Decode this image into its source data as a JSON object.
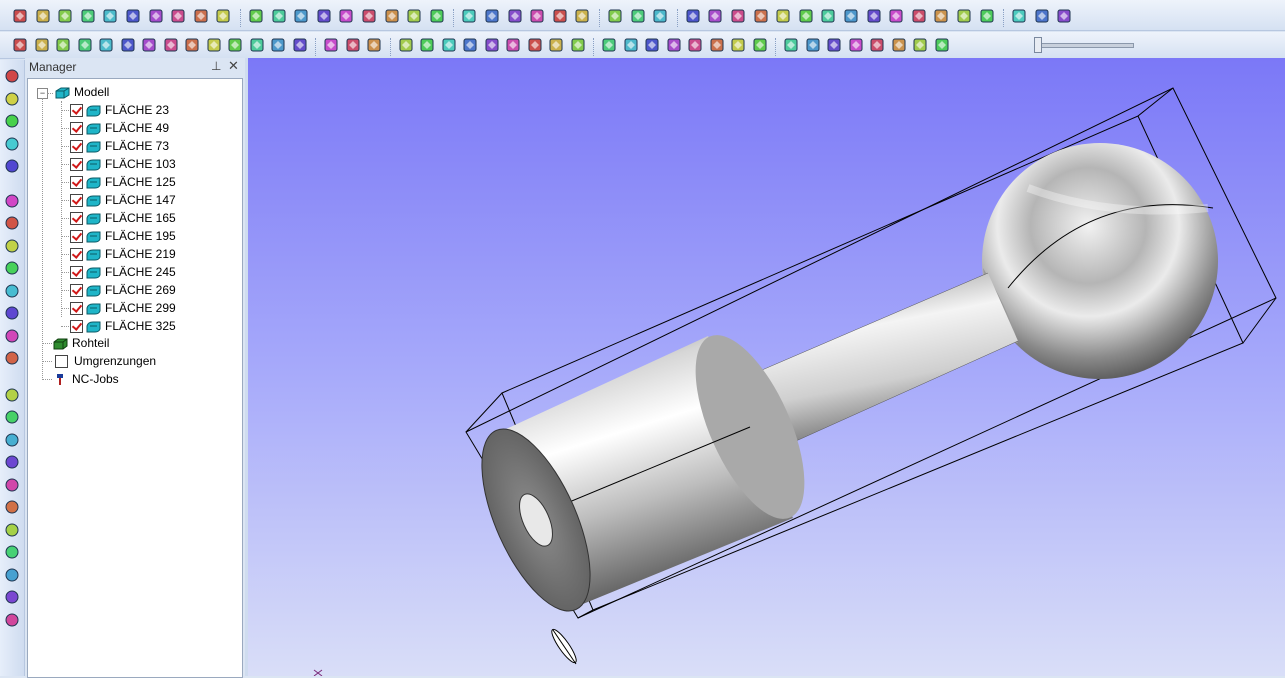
{
  "toolbar1": {
    "icons": [
      "new-file-icon",
      "open-folder-icon",
      "save-icon",
      "cut-icon",
      "copy-icon",
      "paste-icon",
      "print-icon",
      "help-icon",
      "undo-icon",
      "redo-icon",
      "view-front-icon",
      "view-back-icon",
      "view-left-icon",
      "view-right-icon",
      "view-top-icon",
      "view-iso-icon",
      "view-iso-active-icon",
      "view-iso2-icon",
      "view-iso3-icon",
      "layer-2d-icon",
      "layer-3d-icon",
      "spiral-2d-icon",
      "spiral-3d-icon",
      "curve-2d-icon",
      "bars-icon",
      "grid-icon",
      "pen-icon",
      "hatch-icon",
      "layers-icon",
      "layers2-icon",
      "planes-icon",
      "plane-flat-icon",
      "dots-square-icon",
      "target-square-icon",
      "circle-target-icon",
      "circle-rings-icon",
      "stack-icon",
      "lines-stack-icon",
      "concentric-icon",
      "wave-icon",
      "check-tool-icon",
      "brush-tool-icon",
      "square-outline-icon",
      "box-3d-icon",
      "cube-color-icon"
    ]
  },
  "toolbar2": {
    "icons": [
      "snap-points-icon",
      "snap-grid-icon",
      "rotate-cw-icon",
      "rotate-ccw-icon",
      "mirror-h-icon",
      "mirror-v-icon",
      "scale-icon",
      "trim-icon",
      "fillet-icon",
      "cut-scissors-icon",
      "break-icon",
      "delete-x-icon",
      "document-icon",
      "erase-icon",
      "hand-pointer-icon",
      "hand-select-icon",
      "pick-icon",
      "solid-cut-icon",
      "solid-cut2-icon",
      "solid-cut3-icon",
      "solid-cut4-icon",
      "solid-cut5-icon",
      "solid-cut6-icon",
      "solid-cut7-icon",
      "solid-cut8-icon",
      "cross-red-icon",
      "move-icon",
      "pan-hand-icon",
      "zoom-icon",
      "zoom-window-icon",
      "zoom-all-icon",
      "zoom-extents-icon",
      "zoom-in-icon",
      "zoom-out-icon",
      "play-icon",
      "play-step-icon",
      "play-fast-icon",
      "play-faster-icon",
      "skip-end-icon",
      "step-back-icon",
      "skip-start-icon",
      "stop-x-icon"
    ]
  },
  "left_toolbar": {
    "icons": [
      "line-tool-icon",
      "angle-tool-icon",
      "dimension-tool-icon",
      "radius-tool-icon",
      "box-tool-icon",
      "measure-tool-icon",
      "surface-tool-icon",
      "loop-tool-icon",
      "revolve-tool-icon",
      "sweep-tool-icon",
      "intersect-tool-icon",
      "nc-tool-icon",
      "solid-tool-icon",
      "circle-tool-icon",
      "triangle-tool-icon",
      "square-tool-icon",
      "blob-tool-icon",
      "extrude-tool-icon",
      "bottle-tool-icon",
      "bottle2-tool-icon",
      "path-tool-icon",
      "machine-tool-icon",
      "machine2-tool-icon",
      "edit-tool-icon"
    ]
  },
  "manager": {
    "title": "Manager",
    "pin": "⊥",
    "close": "✕"
  },
  "tree": {
    "root": {
      "label": "Modell",
      "expander": "−"
    },
    "faces": [
      {
        "label": "FLÄCHE 23",
        "checked": true
      },
      {
        "label": "FLÄCHE 49",
        "checked": true
      },
      {
        "label": "FLÄCHE 73",
        "checked": true
      },
      {
        "label": "FLÄCHE 103",
        "checked": true
      },
      {
        "label": "FLÄCHE 125",
        "checked": true
      },
      {
        "label": "FLÄCHE 147",
        "checked": true
      },
      {
        "label": "FLÄCHE 165",
        "checked": true
      },
      {
        "label": "FLÄCHE 195",
        "checked": true
      },
      {
        "label": "FLÄCHE 219",
        "checked": true
      },
      {
        "label": "FLÄCHE 245",
        "checked": true
      },
      {
        "label": "FLÄCHE 269",
        "checked": true
      },
      {
        "label": "FLÄCHE 299",
        "checked": true
      },
      {
        "label": "FLÄCHE 325",
        "checked": true
      }
    ],
    "rohteil": "Rohteil",
    "umgrenzungen": "Umgrenzungen",
    "ncjobs": "NC-Jobs"
  },
  "colors": {
    "viewport_top": "#7b78f7",
    "viewport_bottom": "#d9def8",
    "check": "#d01818",
    "face_icon": "#1fb5c8",
    "rohteil_icon": "#2e8b2e"
  }
}
